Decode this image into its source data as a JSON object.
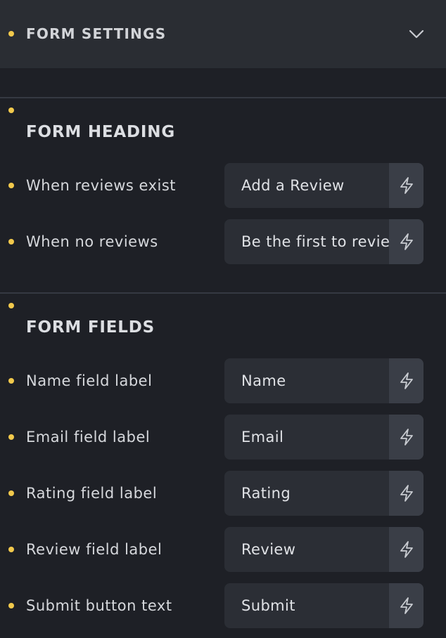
{
  "colors": {
    "background": "#1e2026",
    "header_background": "#2a2d33",
    "field_background": "#2b2e35",
    "dynamic_button_background": "#3a3e47",
    "indicator_dot": "#f2c94c",
    "text": "#d6d8dc"
  },
  "header": {
    "title": "FORM SETTINGS",
    "toggle_icon": "chevron-down-icon"
  },
  "form_heading": {
    "title": "FORM HEADING",
    "rows": [
      {
        "label": "When reviews exist",
        "value": "Add a Review",
        "icon": "bolt-icon"
      },
      {
        "label": "When no reviews",
        "value": "Be the first to review",
        "icon": "bolt-icon"
      }
    ]
  },
  "form_fields": {
    "title": "FORM FIELDS",
    "rows": [
      {
        "label": "Name field label",
        "value": "Name",
        "icon": "bolt-icon"
      },
      {
        "label": "Email field label",
        "value": "Email",
        "icon": "bolt-icon"
      },
      {
        "label": "Rating field label",
        "value": "Rating",
        "icon": "bolt-icon"
      },
      {
        "label": "Review field label",
        "value": "Review",
        "icon": "bolt-icon"
      },
      {
        "label": "Submit button text",
        "value": "Submit",
        "icon": "bolt-icon"
      }
    ]
  }
}
